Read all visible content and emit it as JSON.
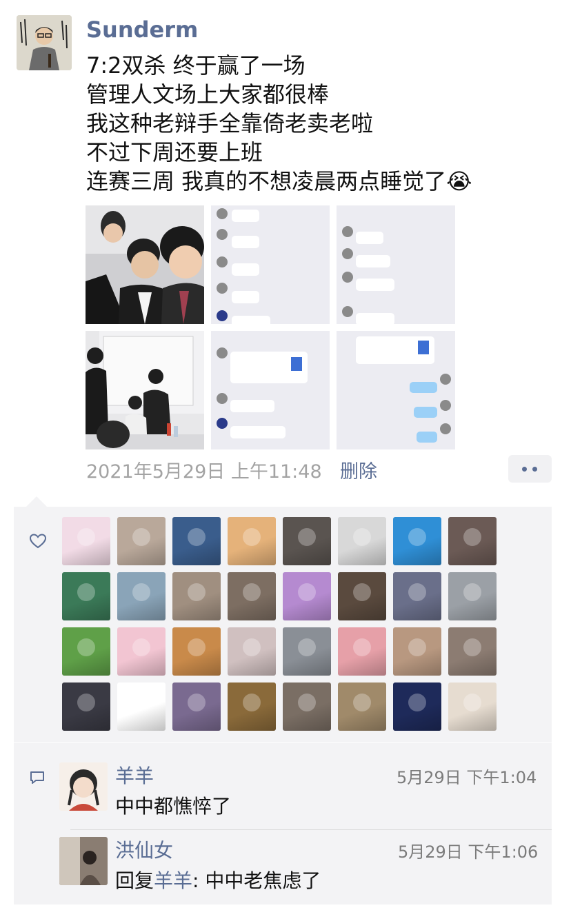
{
  "post": {
    "author": "Sunderm",
    "lines": [
      "7:2双杀 终于赢了一场",
      "管理人文场上大家都很棒",
      "我这种老辩手全靠倚老卖老啦",
      "不过下周还要上班",
      "连赛三周 我真的不想凌晨两点睡觉了😭"
    ],
    "timestamp": "2021年5月29日 上午11:48",
    "delete_label": "删除",
    "photos": [
      {
        "icon": "group-selfie-photo"
      },
      {
        "icon": "chat-screenshot-photo"
      },
      {
        "icon": "chat-screenshot-photo"
      },
      {
        "icon": "debate-room-photo"
      },
      {
        "icon": "chat-screenshot-photo"
      },
      {
        "icon": "chat-screenshot-photo"
      }
    ]
  },
  "likes": {
    "icon": "heart-icon",
    "avatar_colors": [
      "#f2dbe6",
      "#b9a89a",
      "#3a5d8c",
      "#e5b27a",
      "#5a5450",
      "#d8d8d8",
      "#2f8fd6",
      "#6b5a55",
      "#3b7a58",
      "#8aa4b8",
      "#a08f80",
      "#7d6e62",
      "#b58ad0",
      "#5a4a3e",
      "#6a6f8a",
      "#9ba0a6",
      "#5fa048",
      "#f2c5d2",
      "#c98a4a",
      "#d0c0c0",
      "#8a8f96",
      "#e6a0a8",
      "#b89880",
      "#8c7c72",
      "#3a3a44",
      "#ffffff",
      "#7a6a90",
      "#8a6a3a",
      "#7a6e64",
      "#a08a6a",
      "#1e2a5a",
      "#e6dcd0"
    ]
  },
  "comments": {
    "icon": "comment-icon",
    "items": [
      {
        "name": "羊羊",
        "time": "5月29日 下午1:04",
        "text": "中中都憔悴了"
      },
      {
        "name": "洪仙女",
        "time": "5月29日 下午1:06",
        "reply_prefix": "回复",
        "reply_to": "羊羊",
        "reply_text": ": 中中老焦虑了"
      }
    ]
  }
}
